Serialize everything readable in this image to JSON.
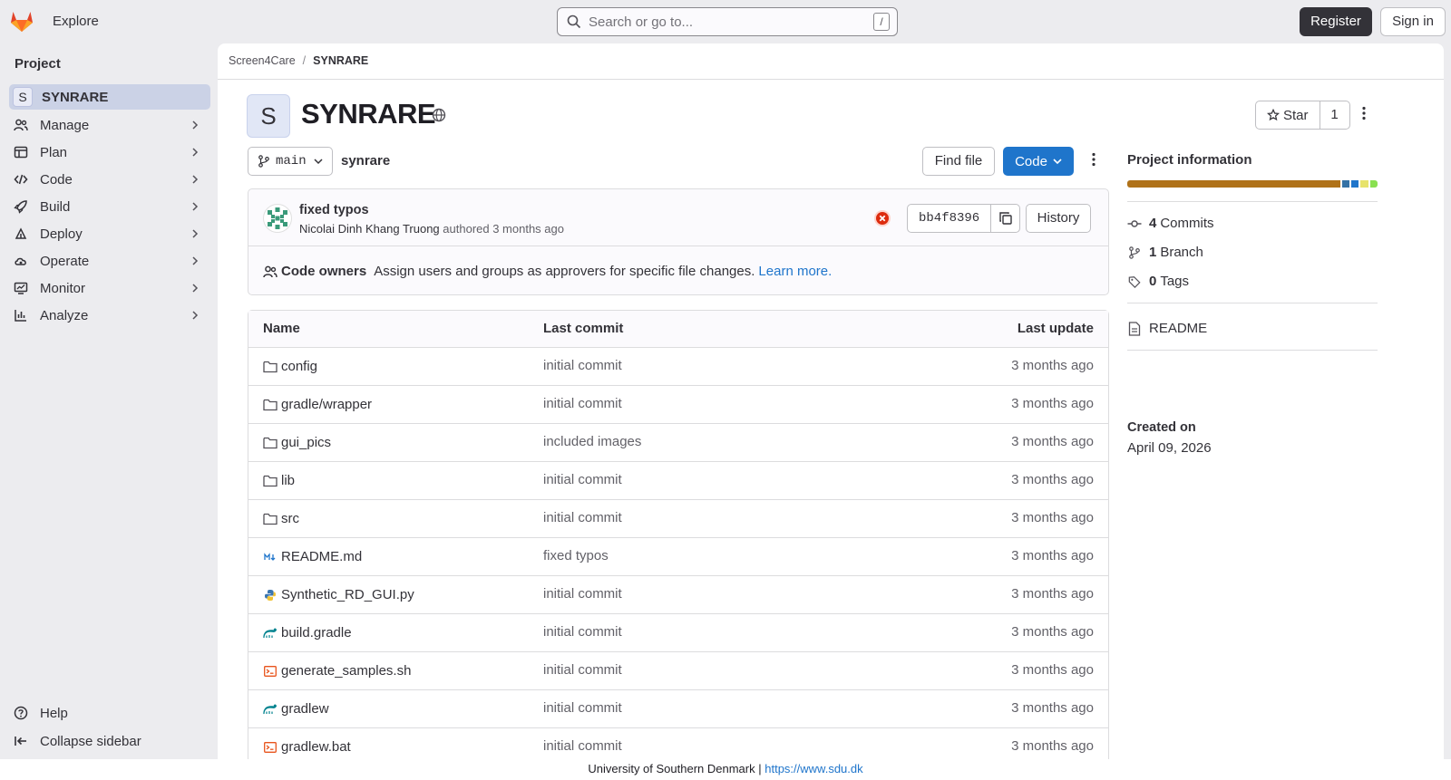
{
  "topbar": {
    "explore_label": "Explore",
    "search_placeholder": "Search or go to...",
    "search_shortcut": "/",
    "register_label": "Register",
    "signin_label": "Sign in"
  },
  "sidebar": {
    "section_title": "Project",
    "project_initial": "S",
    "project_name": "SYNRARE",
    "items": [
      {
        "label": "Manage",
        "icon": "users-icon"
      },
      {
        "label": "Plan",
        "icon": "planning-icon"
      },
      {
        "label": "Code",
        "icon": "code-icon"
      },
      {
        "label": "Build",
        "icon": "rocket-icon"
      },
      {
        "label": "Deploy",
        "icon": "deploy-icon"
      },
      {
        "label": "Operate",
        "icon": "cloud-gear-icon"
      },
      {
        "label": "Monitor",
        "icon": "monitor-icon"
      },
      {
        "label": "Analyze",
        "icon": "chart-icon"
      }
    ],
    "help_label": "Help",
    "collapse_label": "Collapse sidebar"
  },
  "breadcrumb": {
    "group": "Screen4Care",
    "separator": "/",
    "project": "SYNRARE"
  },
  "project": {
    "initial": "S",
    "name": "SYNRARE",
    "star_label": "Star",
    "star_count": "1",
    "branch": "main",
    "path": "synrare",
    "find_file_label": "Find file",
    "code_label": "Code"
  },
  "commit": {
    "title": "fixed typos",
    "author": "Nicolai Dinh Khang Truong",
    "authored_text": "authored 3 months ago",
    "sha": "bb4f8396",
    "history_label": "History",
    "status": "failed"
  },
  "code_owners": {
    "title": "Code owners",
    "description": "Assign users and groups as approvers for specific file changes.",
    "link": "Learn more."
  },
  "files": {
    "headers": {
      "name": "Name",
      "last_commit": "Last commit",
      "last_update": "Last update"
    },
    "rows": [
      {
        "name": "config",
        "icon": "folder-icon",
        "commit": "initial commit",
        "updated": "3 months ago"
      },
      {
        "name": "gradle/wrapper",
        "icon": "folder-icon",
        "commit": "initial commit",
        "updated": "3 months ago"
      },
      {
        "name": "gui_pics",
        "icon": "folder-icon",
        "commit": "included images",
        "updated": "3 months ago"
      },
      {
        "name": "lib",
        "icon": "folder-icon",
        "commit": "initial commit",
        "updated": "3 months ago"
      },
      {
        "name": "src",
        "icon": "folder-icon",
        "commit": "initial commit",
        "updated": "3 months ago"
      },
      {
        "name": "README.md",
        "icon": "markdown-icon",
        "commit": "fixed typos",
        "updated": "3 months ago"
      },
      {
        "name": "Synthetic_RD_GUI.py",
        "icon": "python-icon",
        "commit": "initial commit",
        "updated": "3 months ago"
      },
      {
        "name": "build.gradle",
        "icon": "gradle-icon",
        "commit": "initial commit",
        "updated": "3 months ago"
      },
      {
        "name": "generate_samples.sh",
        "icon": "shell-icon",
        "commit": "initial commit",
        "updated": "3 months ago"
      },
      {
        "name": "gradlew",
        "icon": "gradle-icon",
        "commit": "initial commit",
        "updated": "3 months ago"
      },
      {
        "name": "gradlew.bat",
        "icon": "shell-icon",
        "commit": "initial commit",
        "updated": "3 months ago"
      }
    ]
  },
  "info": {
    "title": "Project information",
    "languages": [
      {
        "color": "#b07219",
        "share": 85
      },
      {
        "color": "#3572a5",
        "share": 3
      },
      {
        "color": "#1f75cb",
        "share": 3
      },
      {
        "color": "#e7e36b",
        "share": 3
      },
      {
        "color": "#89e051",
        "share": 3
      }
    ],
    "commits_count": "4",
    "commits_label": "Commits",
    "branches_count": "1",
    "branches_label": "Branch",
    "tags_count": "0",
    "tags_label": "Tags",
    "readme_label": "README",
    "created_label": "Created on",
    "created_date": "April 09, 2026"
  },
  "footer": {
    "text": "University of Southern Denmark |",
    "link": "https://www.sdu.dk"
  }
}
